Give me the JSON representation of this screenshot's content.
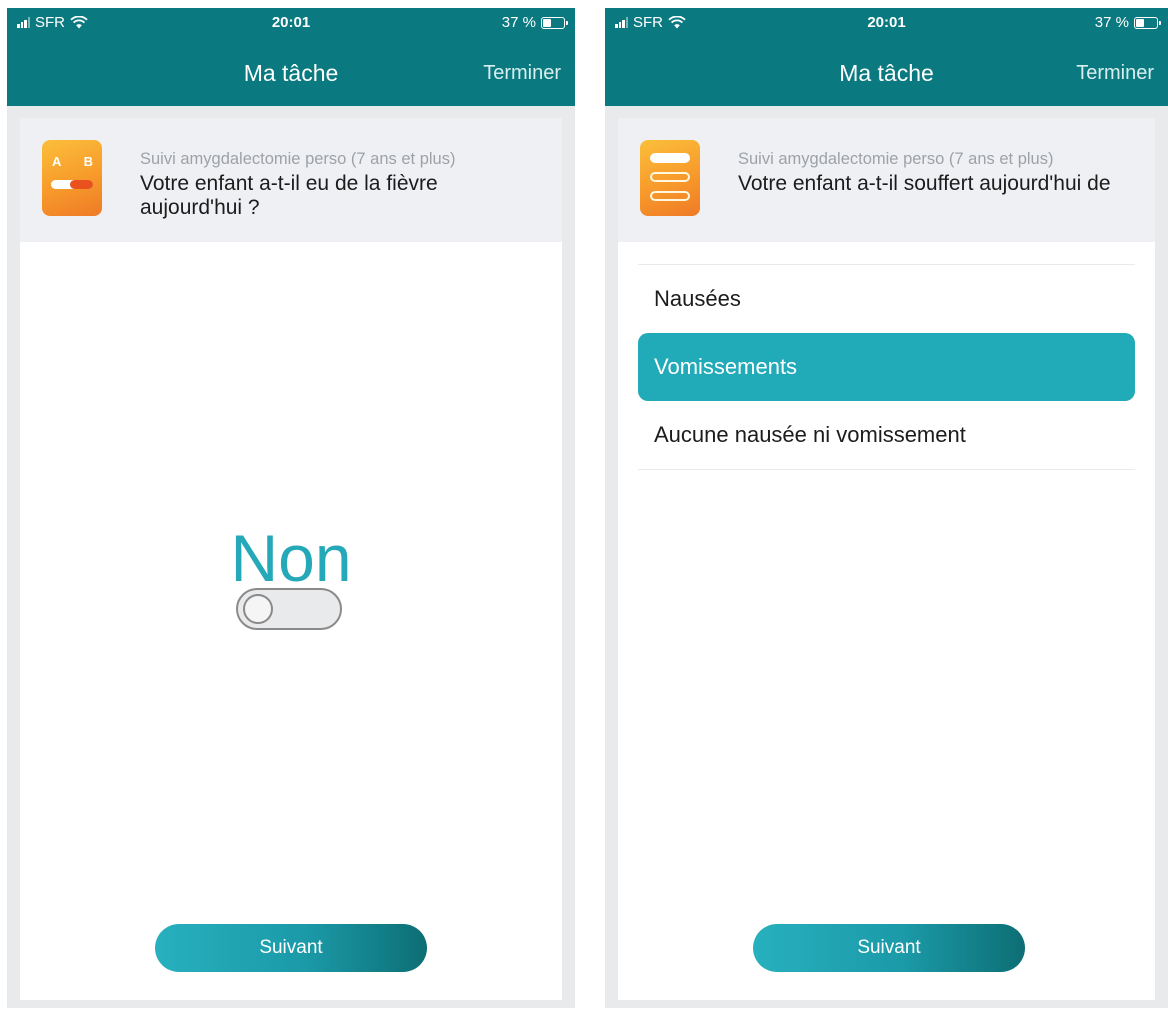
{
  "colors": {
    "header_teal": "#0a7a80",
    "accent": "#21aab8",
    "icon_orange": "#f79a2b"
  },
  "screens": [
    {
      "status": {
        "carrier": "SFR",
        "time": "20:01",
        "battery": "37 %"
      },
      "nav": {
        "title": "Ma tâche",
        "action": "Terminer"
      },
      "question": {
        "survey": "Suivi amygdalectomie perso (7 ans et plus)",
        "text": "Votre enfant a-t-il eu de la fièvre aujourd'hui ?",
        "icon": "a-b-scale-icon",
        "icon_a": "A",
        "icon_b": "B"
      },
      "toggle": {
        "label": "Non",
        "on": false
      },
      "next_label": "Suivant"
    },
    {
      "status": {
        "carrier": "SFR",
        "time": "20:01",
        "battery": "37 %"
      },
      "nav": {
        "title": "Ma tâche",
        "action": "Terminer"
      },
      "question": {
        "survey": "Suivi amygdalectomie perso (7 ans et plus)",
        "text": "Votre enfant a-t-il souffert aujourd'hui de",
        "icon": "choice-list-icon"
      },
      "options": [
        {
          "label": "Nausées",
          "selected": false
        },
        {
          "label": "Vomissements",
          "selected": true
        },
        {
          "label": "Aucune nausée ni vomissement",
          "selected": false
        }
      ],
      "next_label": "Suivant"
    }
  ]
}
